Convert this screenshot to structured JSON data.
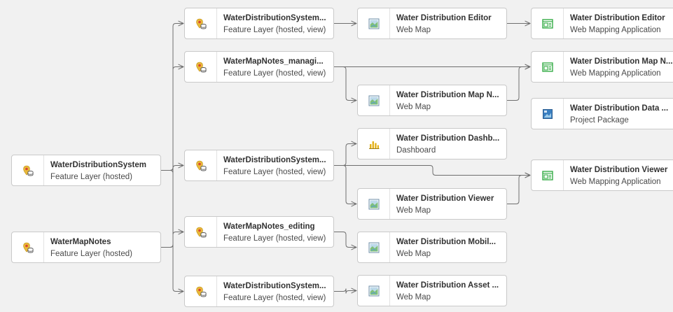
{
  "nodes": [
    {
      "id": "src-wds",
      "icon": "feature-layer-icon",
      "title": "WaterDistributionSystem",
      "subtitle": "Feature Layer (hosted)"
    },
    {
      "id": "src-wmn",
      "icon": "feature-layer-icon",
      "title": "WaterMapNotes",
      "subtitle": "Feature Layer (hosted)"
    },
    {
      "id": "view-1",
      "icon": "feature-layer-icon",
      "title": "WaterDistributionSystem...",
      "subtitle": "Feature Layer (hosted, view)"
    },
    {
      "id": "view-2",
      "icon": "feature-layer-icon",
      "title": "WaterMapNotes_managi...",
      "subtitle": "Feature Layer (hosted, view)"
    },
    {
      "id": "view-3",
      "icon": "feature-layer-icon",
      "title": "WaterDistributionSystem...",
      "subtitle": "Feature Layer (hosted, view)"
    },
    {
      "id": "view-4",
      "icon": "feature-layer-icon",
      "title": "WaterMapNotes_editing",
      "subtitle": "Feature Layer (hosted, view)"
    },
    {
      "id": "view-5",
      "icon": "feature-layer-icon",
      "title": "WaterDistributionSystem...",
      "subtitle": "Feature Layer (hosted, view)"
    },
    {
      "id": "map-editor",
      "icon": "web-map-icon",
      "title": "Water Distribution Editor",
      "subtitle": "Web Map"
    },
    {
      "id": "map-notes",
      "icon": "web-map-icon",
      "title": "Water Distribution Map N...",
      "subtitle": "Web Map"
    },
    {
      "id": "dashboard",
      "icon": "dashboard-icon",
      "title": "Water Distribution Dashb...",
      "subtitle": "Dashboard"
    },
    {
      "id": "map-viewer",
      "icon": "web-map-icon",
      "title": "Water Distribution Viewer",
      "subtitle": "Web Map"
    },
    {
      "id": "map-mobile",
      "icon": "web-map-icon",
      "title": "Water Distribution Mobil...",
      "subtitle": "Web Map"
    },
    {
      "id": "map-asset",
      "icon": "web-map-icon",
      "title": "Water Distribution Asset ...",
      "subtitle": "Web Map"
    },
    {
      "id": "app-editor",
      "icon": "web-app-icon",
      "title": "Water Distribution Editor",
      "subtitle": "Web Mapping Application"
    },
    {
      "id": "app-notes",
      "icon": "web-app-icon",
      "title": "Water Distribution Map N...",
      "subtitle": "Web Mapping Application"
    },
    {
      "id": "project-pkg",
      "icon": "project-package-icon",
      "title": "Water Distribution Data ...",
      "subtitle": "Project Package"
    },
    {
      "id": "app-viewer",
      "icon": "web-app-icon",
      "title": "Water Distribution Viewer",
      "subtitle": "Web Mapping Application"
    }
  ],
  "links": [
    [
      "src-wds",
      "view-1"
    ],
    [
      "src-wds",
      "view-3"
    ],
    [
      "src-wds",
      "view-5"
    ],
    [
      "src-wmn",
      "view-2"
    ],
    [
      "src-wmn",
      "view-4"
    ],
    [
      "view-1",
      "map-editor"
    ],
    [
      "view-2",
      "app-notes"
    ],
    [
      "view-2",
      "map-notes"
    ],
    [
      "view-3",
      "dashboard"
    ],
    [
      "view-3",
      "app-viewer"
    ],
    [
      "view-3",
      "map-viewer"
    ],
    [
      "view-4",
      "map-mobile"
    ],
    [
      "view-5",
      "map-asset"
    ],
    [
      "map-editor",
      "app-editor"
    ],
    [
      "map-notes",
      "app-notes"
    ],
    [
      "map-viewer",
      "app-viewer"
    ]
  ],
  "colors": {
    "background": "#f1f1f1",
    "link": "#6e6e6e",
    "feature_layer": "#e8b93a",
    "web_app": "#35ac46",
    "web_map": "#5a9fd4",
    "dashboard": "#e3b11b",
    "project_package": "#3a7fc1"
  }
}
